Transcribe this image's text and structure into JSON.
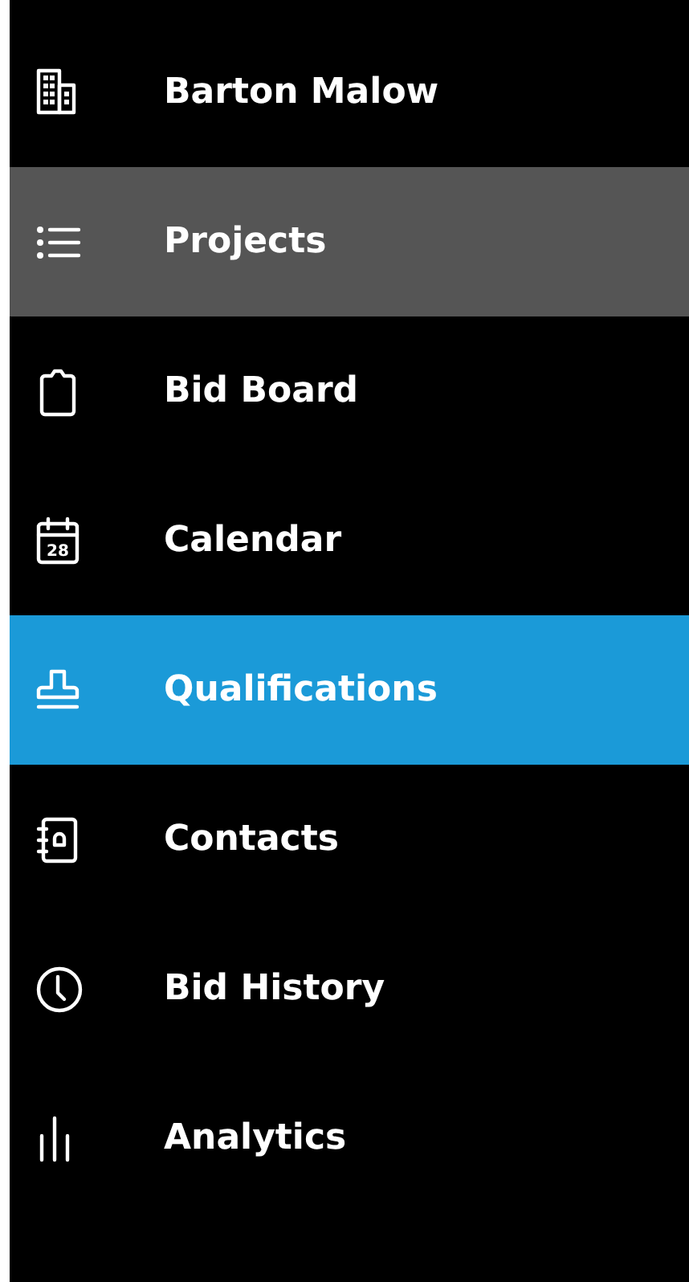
{
  "menu": {
    "items": [
      {
        "label": "Barton Malow",
        "kind": "building",
        "selected": false,
        "hovered": false
      },
      {
        "label": "Projects",
        "kind": "list",
        "selected": false,
        "hovered": true
      },
      {
        "label": "Bid Board",
        "kind": "clipboard",
        "selected": false,
        "hovered": false
      },
      {
        "label": "Calendar",
        "kind": "calendar",
        "icon_text": "28",
        "selected": false,
        "hovered": false
      },
      {
        "label": "Qualifications",
        "kind": "stamp",
        "selected": true,
        "hovered": false
      },
      {
        "label": "Contacts",
        "kind": "contacts",
        "selected": false,
        "hovered": false
      },
      {
        "label": "Bid History",
        "kind": "clock",
        "selected": false,
        "hovered": false
      },
      {
        "label": "Analytics",
        "kind": "bars",
        "selected": false,
        "hovered": false
      }
    ]
  }
}
